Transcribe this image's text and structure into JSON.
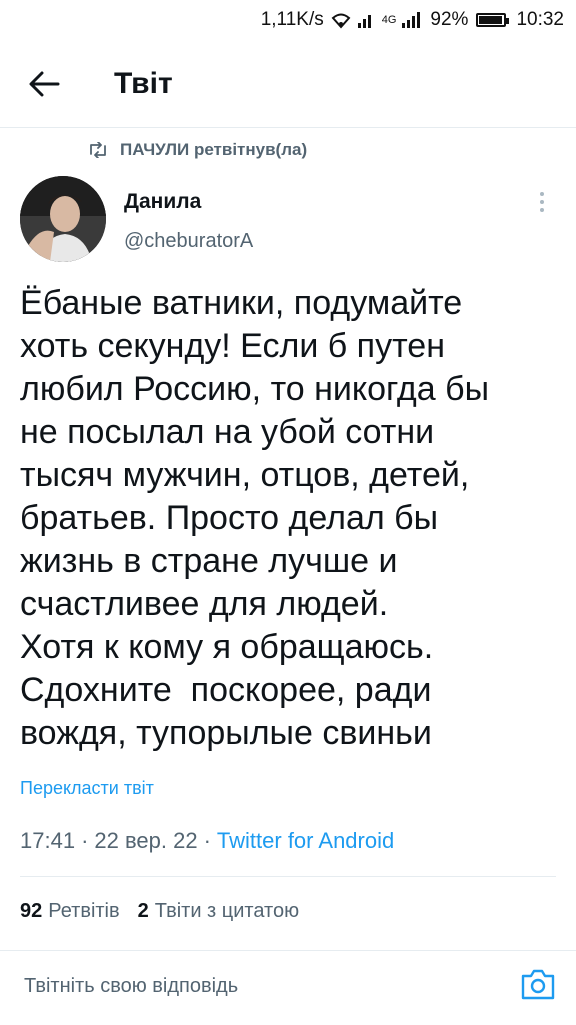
{
  "status_bar": {
    "speed": "1,11K/s",
    "network": "4G",
    "battery": "92%",
    "time": "10:32"
  },
  "header": {
    "title": "Твіт"
  },
  "retweet": {
    "text": "ПАЧУЛИ ретвітнув(ла)"
  },
  "author": {
    "name": "Данила",
    "handle": "@cheburatorA"
  },
  "tweet": {
    "text": "Ёбаные ватники, подумайте\nхоть секунду! Если б путен\nлюбил Россию, то никогда бы\nне посылал на убой сотни\nтысяч мужчин, отцов, детей,\nбратьев. Просто делал бы\nжизнь в стране лучше и\nсчастливее для людей.\nХотя к кому я обращаюсь.\nСдохните  поскорее, ради\nвождя, тупорылые свиньи",
    "translate_label": "Перекласти твіт",
    "time": "17:41",
    "date": "22 вер. 22",
    "client": "Twitter for Android"
  },
  "stats": {
    "retweets_count": "92",
    "retweets_label": "Ретвітів",
    "quotes_count": "2",
    "quotes_label": "Твіти з цитатою"
  },
  "reply": {
    "placeholder": "Твітніть свою відповідь"
  },
  "colors": {
    "accent": "#1d9bf0",
    "secondary_text": "#536471",
    "divider": "#e6ecf0"
  }
}
